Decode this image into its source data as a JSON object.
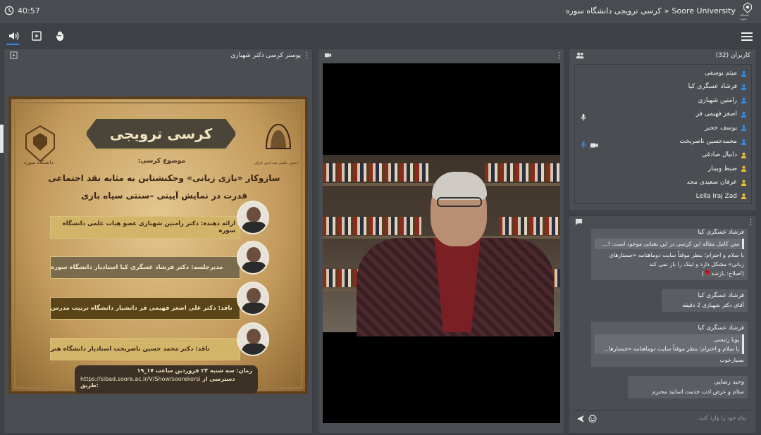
{
  "header": {
    "timer": "40:57",
    "breadcrumb_root": "Soore University",
    "breadcrumb_sep": "»",
    "breadcrumb_room": "کرسی ترویجی دانشگاه سوره",
    "logo_text": "دانشگاه سوره"
  },
  "toolbar": {
    "audio_icon": "speaker-icon",
    "share_icon": "share-screen-icon",
    "raise_hand_icon": "raise-hand-icon",
    "menu_icon": "hamburger-icon"
  },
  "share_pod": {
    "title": "پوستر کرسی دکتر شهبازی"
  },
  "poster": {
    "banner": "کرسی ترویجی",
    "topic_label": "موضوع کرسی:",
    "title_line1": "سازوکار «بازی زبانی» وجکنشتاین به مثابه نقد اجتماعی",
    "title_line2": "قدرت در نمایش آیینی –سنتی سیاه بازی",
    "presenter": "ارائه دهنده: دکتر رامتین شهبازی عضو هیات علمی دانشگاه سوره",
    "moderator": "مدیرجلسه: دکتر فرشاد عسگری کیا استادیار دانشگاه سوره",
    "critic1": "ناقد: دکتر علی اصغر فهیمی فر دانشیار دانشگاه تربیت مدرس",
    "critic2": "ناقد: دکتر محمد حسین ناصربخت استادیار دانشگاه هنر",
    "time": "زمان: سه شنبه ۲۴ فروردین ساعت ۱۷_۱۹",
    "access_label": "دسترسی از طریق:",
    "url": "https://sibad.soore.ac.ir/V/Show/soorekorsi",
    "left_crest_caption": "دانشگاه سوره",
    "right_crest_caption": "انجمن علمی نقد ادبی ایران"
  },
  "users": {
    "title": "کاربران (32)",
    "list": [
      {
        "name": "میثم یوسفی",
        "role": "host",
        "mic": false,
        "cam": false
      },
      {
        "name": "فرشاد عسگری کیا",
        "role": "host",
        "mic": false,
        "cam": false
      },
      {
        "name": "رامتین شهبازی",
        "role": "host",
        "mic": false,
        "cam": false
      },
      {
        "name": "اصغر فهیمی فر",
        "role": "host",
        "mic": true,
        "cam": false
      },
      {
        "name": "یوسف خجیر",
        "role": "host",
        "mic": false,
        "cam": false
      },
      {
        "name": "محمدحسین ناصربخت",
        "role": "host",
        "mic": true,
        "cam": true
      },
      {
        "name": "دانیال صادقی",
        "role": "guest",
        "mic": false,
        "cam": false
      },
      {
        "name": "ضبط وبینار",
        "role": "guest",
        "mic": false,
        "cam": false
      },
      {
        "name": "عرفان سعیدی مجد",
        "role": "guest",
        "mic": false,
        "cam": false
      },
      {
        "name": "Leila Iraj Zad",
        "role": "guest",
        "mic": false,
        "cam": false
      }
    ]
  },
  "chat": {
    "messages": [
      {
        "name": "فرشاد عسگری کیا",
        "quote": "متن کامل مقاله این کرسی در این نشانی موجود است: ا...",
        "text": "با سلام و احترام؛ بنظر موقتاً سایت دوماهنامه «جستارهای زبانی» مشکل دارد و لینک را باز نمی کند",
        "extra": "(اصلاح: بازشد🌹)"
      },
      {
        "name": "فرشاد عسگری کیا",
        "text": "آقای دکتر شهبازی 2 دقیقه"
      },
      {
        "name": "فرشاد عسگری کیا",
        "quote_name": "پویا رئیسی",
        "quote": "با سلام و احترام؛ بنظر موقتاً سایت دوماهنامه «جستارها...",
        "text": "بسیارخوب"
      },
      {
        "name": "وحید رضایی",
        "text": "سلام و عرض ادب خدمت اساتید محترم"
      }
    ],
    "input_placeholder": "پیام خود را وارد کنید."
  },
  "colors": {
    "accent": "#2f8fe8",
    "host_icon": "#2f8fe8",
    "guest_icon": "#f2c12e"
  }
}
